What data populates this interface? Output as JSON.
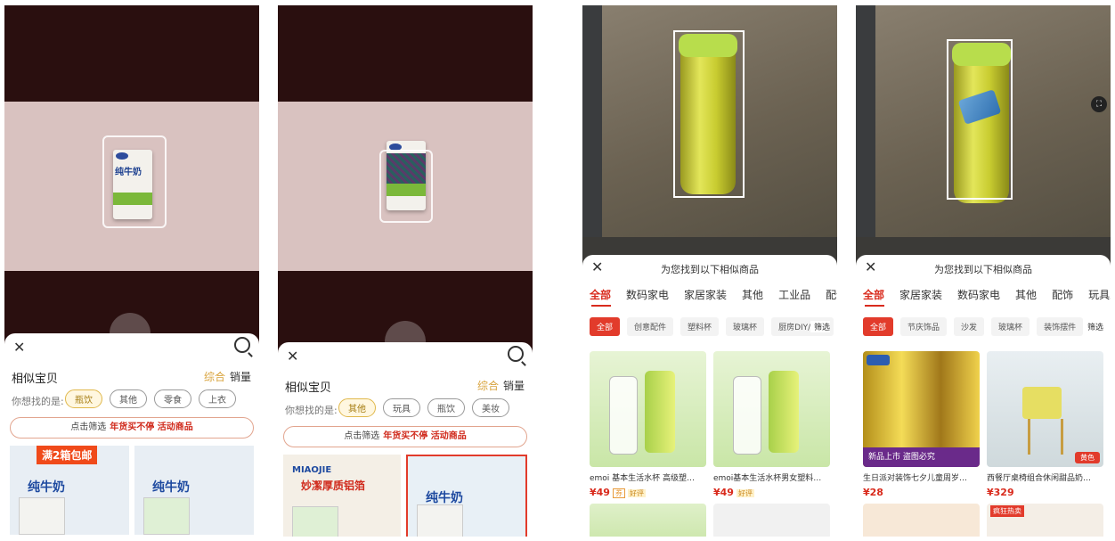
{
  "screens": [
    {
      "id": "milk-scan",
      "sheet": {
        "title": "相似宝贝",
        "sort_options": [
          "综合",
          "销量"
        ],
        "question": "你想找的是:",
        "chips": [
          "瓶饮",
          "其他",
          "零食",
          "上衣"
        ],
        "selected_chip": "瓶饮",
        "banner_prefix": "点击筛选",
        "banner_highlight": "年货买不停  活动商品",
        "thumbs": [
          {
            "tag": "满2箱包邮",
            "title": "纯牛奶"
          },
          {
            "title": "纯牛奶"
          }
        ]
      }
    },
    {
      "id": "milk-scan-2",
      "sheet": {
        "title": "相似宝贝",
        "sort_options": [
          "综合",
          "销量"
        ],
        "question": "你想找的是:",
        "chips": [
          "其他",
          "玩具",
          "瓶饮",
          "美妆"
        ],
        "selected_chip": "其他",
        "banner_prefix": "点击筛选",
        "banner_highlight": "年货买不停  活动商品",
        "thumbs": [
          {
            "brand": "MIAOJIE",
            "title": "妙潔厚质铝箔"
          },
          {
            "title": "纯牛奶"
          }
        ]
      }
    },
    {
      "id": "bottle-scan",
      "results": {
        "title": "为您找到以下相似商品",
        "tabs": [
          "全部",
          "数码家电",
          "家居家装",
          "其他",
          "工业品",
          "配饰"
        ],
        "subtabs": [
          "全部",
          "创意配件",
          "塑料杯",
          "玻璃杯",
          "厨房DIY/小工"
        ],
        "filter": "筛选",
        "items": [
          {
            "name": "emoi 基本生活水杯 高级塑…",
            "price": "¥49",
            "badges": [
              "券",
              "好评"
            ]
          },
          {
            "name": "emoi基本生活水杯男女塑料…",
            "price": "¥49",
            "badges": [
              "好评"
            ]
          }
        ]
      }
    },
    {
      "id": "bottle-scan-2",
      "results": {
        "title": "为您找到以下相似商品",
        "tabs": [
          "全部",
          "家居家装",
          "数码家电",
          "其他",
          "配饰",
          "玩具乐"
        ],
        "subtabs": [
          "全部",
          "节庆饰品",
          "沙发",
          "玻璃杯",
          "装饰摆件"
        ],
        "filter": "筛选",
        "items": [
          {
            "name": "生日派对装饰七夕儿童周岁…",
            "price": "¥28",
            "badge_text": "新品上市  盗图必究"
          },
          {
            "name": "西餐厅桌椅组合休闲甜品奶…",
            "price": "¥329",
            "badge_text": "黄色"
          }
        ],
        "extra_tag": "疯狂热卖"
      }
    }
  ]
}
